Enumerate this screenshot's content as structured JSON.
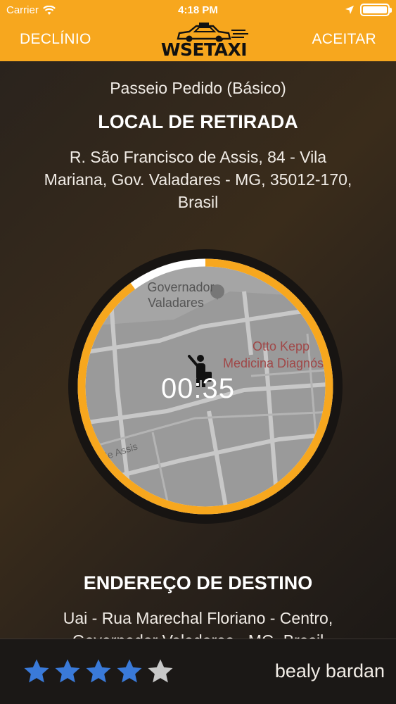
{
  "status_bar": {
    "carrier": "Carrier",
    "time": "4:18 PM"
  },
  "header": {
    "decline_label": "DECLÍNIO",
    "accept_label": "ACEITAR",
    "logo_text": "WSETÁXI",
    "background_color": "#f7a71e"
  },
  "ride": {
    "type_label": "Passeio Pedido (Básico)",
    "pickup_title": "LOCAL DE RETIRADA",
    "pickup_address_lines": [
      "R. São Francisco de Assis,  84 - Vila",
      "Mariana,  Gov. Valadares - MG,  35012-170,",
      "Brasil"
    ],
    "timer": "00:35",
    "timer_progress": 0.9,
    "destination_title": "ENDEREÇO DE DESTINO",
    "destination_address_lines": [
      "Uai - Rua Marechal Floriano - Centro,",
      "Governador Valadares - MG, Brasil"
    ]
  },
  "map": {
    "place_1_line1": "Governador",
    "place_1_line2": "Valadares",
    "place_2_line1": "Otto Kepp",
    "place_2_line2": "Medicina Diagnóstic",
    "street": "de Assis",
    "marker_icon": "person-waving-icon"
  },
  "driver": {
    "rating": 4,
    "max_rating": 5,
    "name": "bealy bardan",
    "star_color": "#3a7ad9",
    "empty_star_color": "#c8c8c8"
  }
}
